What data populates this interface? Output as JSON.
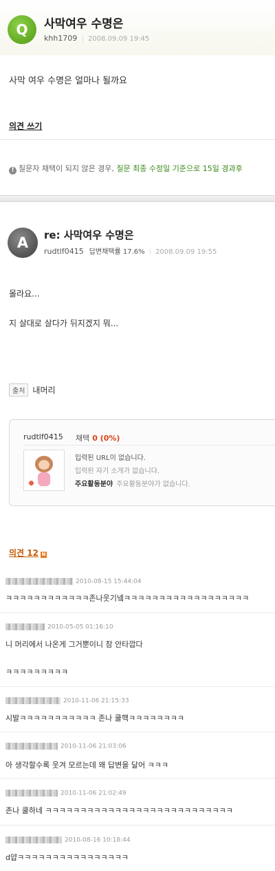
{
  "question": {
    "badge": "Q",
    "title": "사막여우 수명은",
    "user": "khh1709",
    "date": "2008.09.09 19:45",
    "body": "사막 여우 수명은 얼마나 될까요",
    "write_opinion": "의견 쓰기",
    "notice_prefix": "질문자 채택이 되지 않은 경우,",
    "notice_highlight": "질문 최종 수정일 기준으로 15일 경과후"
  },
  "answer": {
    "badge": "A",
    "title": "re: 사막여우 수명은",
    "user": "rudtlf0415",
    "adoption_rate": "답변채택률 17.6%",
    "date": "2008.09.09 19:55",
    "lines": [
      "몰라요...",
      "지 살대로 살다가 뒤지겠지 뭐..."
    ],
    "source_label": "출처",
    "source_value": "내머리"
  },
  "profile_card": {
    "user": "rudtlf0415",
    "adopt_label": "채택",
    "adopt_count": "0 (0%)",
    "url_text": "입력된 URL이 없습니다.",
    "intro_text": "입력된 자기 소개가 없습니다.",
    "field_label": "주요활동분야",
    "field_value": "주요활동분야가 없습니다."
  },
  "opinions": {
    "label": "의견 12",
    "new_badge": "N",
    "comments": [
      {
        "date": "2010-08-15 15:44:04",
        "lines": [
          "ㅋㅋㅋㅋㅋㅋㅋㅋㅋㅋㅋㅋ존나웃기넼ㅋㅋㅋㅋㅋㅋㅋㅋㅋㅋㅋㅋㅋㅋㅋㅋㅋㅋ"
        ]
      },
      {
        "date": "2010-05-05 01:16:10",
        "lines": [
          "니 머리에서 나온게 그거뿐이니 참 안타깝다",
          "ㅋㅋㅋㅋㅋㅋㅋㅋㅋ"
        ]
      },
      {
        "date": "2010-11-06 21:15:33",
        "lines": [
          "시발ㅋㅋㅋㅋㅋㅋㅋㅋㅋㅋㅋ 존나 쿨핵ㅋㅋㅋㅋㅋㅋㅋㅋ"
        ]
      },
      {
        "date": "2010-11-06 21:03:06",
        "lines": [
          "아 생각할수록 웃겨 모르는데 왜 답변을 달어 ㅋㅋㅋ"
        ]
      },
      {
        "date": "2010-11-06 21:02:49",
        "lines": [
          "존나 쿨하네 ㅋㅋㅋㅋㅋㅋㅋㅋㅋㅋㅋㅋㅋㅋㅋㅋㅋㅋㅋㅋㅋㅋㅋㅋㅋㅋㅋ"
        ]
      },
      {
        "date": "2010-08-16 10:18:44",
        "lines": [
          "d얍ㅋㅋㅋㅋㅋㅋㅋㅋㅋㅋㅋㅋㅋㅋㅋㅋ"
        ]
      }
    ]
  }
}
